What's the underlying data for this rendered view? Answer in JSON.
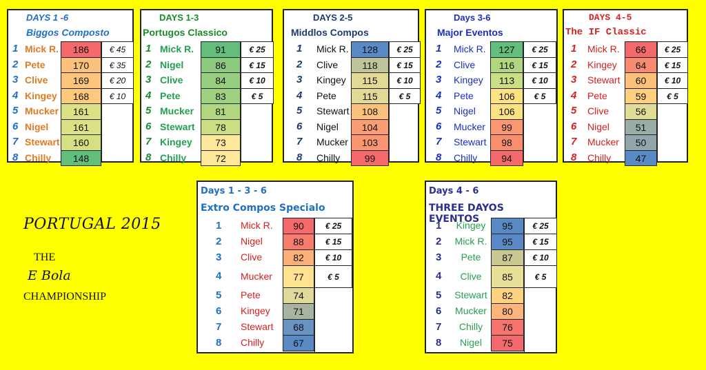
{
  "side_text": {
    "title": "PORTUGAL 2015",
    "the": "THE",
    "name": "E Bola",
    "championship": "CHAMPIONSHIP"
  },
  "tables": [
    {
      "days": "DAYS 1 -6",
      "title": "Biggos Composto",
      "title_color": "#1f6fc5",
      "name_color": "#e07b22",
      "rank_color": "#1f6fc5",
      "rows": [
        {
          "rank": "1",
          "name": "Mick R.",
          "score": "186",
          "color": "#f4696b",
          "prize": "€ 45"
        },
        {
          "rank": "2",
          "name": "Pete",
          "score": "170",
          "color": "#fcc17c",
          "prize": "€ 35"
        },
        {
          "rank": "3",
          "name": "Clive",
          "score": "169",
          "color": "#fcc47c",
          "prize": "€ 20"
        },
        {
          "rank": "4",
          "name": "Kingey",
          "score": "168",
          "color": "#fcc97d",
          "prize": "€ 10"
        },
        {
          "rank": "5",
          "name": "Mucker",
          "score": "161",
          "color": "#dce283",
          "prize": ""
        },
        {
          "rank": "6",
          "name": "Nigel",
          "score": "161",
          "color": "#dce283",
          "prize": ""
        },
        {
          "rank": "7",
          "name": "Stewart",
          "score": "160",
          "color": "#d5e083",
          "prize": ""
        },
        {
          "rank": "8",
          "name": "Chilly",
          "score": "148",
          "color": "#63be7b",
          "prize": ""
        }
      ]
    },
    {
      "days": "DAYS 1-3",
      "title": "Portugos Classico",
      "title_color": "#1a8a2a",
      "name_color": "#25a050",
      "rank_color": "#1a8a2a",
      "rows": [
        {
          "rank": "1",
          "name": "Mick R.",
          "score": "91",
          "color": "#63be7b",
          "prize": "€ 25"
        },
        {
          "rank": "2",
          "name": "Nigel",
          "score": "86",
          "color": "#8ccb7e",
          "prize": "€ 15"
        },
        {
          "rank": "3",
          "name": "Clive",
          "score": "84",
          "color": "#97ce7f",
          "prize": "€ 10"
        },
        {
          "rank": "4",
          "name": "Pete",
          "score": "83",
          "color": "#a0d180",
          "prize": "€ 5"
        },
        {
          "rank": "5",
          "name": "Mucker",
          "score": "81",
          "color": "#b1d680",
          "prize": ""
        },
        {
          "rank": "6",
          "name": "Stewart",
          "score": "78",
          "color": "#cade83",
          "prize": ""
        },
        {
          "rank": "7",
          "name": "Kingey",
          "score": "73",
          "color": "#fde89a",
          "prize": ""
        },
        {
          "rank": "8",
          "name": "Chilly",
          "score": "72",
          "color": "#fde89a",
          "prize": ""
        }
      ]
    },
    {
      "days": "DAYS 2-5",
      "title": "Middlos Compos",
      "title_color": "#1f3a70",
      "name_color": "#111111",
      "rank_color": "#1f3a70",
      "rows": [
        {
          "rank": "1",
          "name": "Mick R.",
          "score": "128",
          "color": "#5a8ac6",
          "prize": "€ 25"
        },
        {
          "rank": "2",
          "name": "Clive",
          "score": "118",
          "color": "#bfc49b",
          "prize": "€ 15"
        },
        {
          "rank": "3",
          "name": "Kingey",
          "score": "115",
          "color": "#e1d995",
          "prize": "€ 10"
        },
        {
          "rank": "4",
          "name": "Pete",
          "score": "115",
          "color": "#e1d995",
          "prize": "€ 5"
        },
        {
          "rank": "5",
          "name": "Stewart",
          "score": "108",
          "color": "#fcc27c",
          "prize": ""
        },
        {
          "rank": "6",
          "name": "Nigel",
          "score": "104",
          "color": "#fa9c74",
          "prize": ""
        },
        {
          "rank": "7",
          "name": "Mucker",
          "score": "103",
          "color": "#fa9572",
          "prize": ""
        },
        {
          "rank": "8",
          "name": "Chilly",
          "score": "99",
          "color": "#f4696b",
          "prize": ""
        }
      ]
    },
    {
      "days": "Days 3-6",
      "title": "Major Eventos",
      "title_color": "#1a2fc0",
      "name_color": "#1a2fc0",
      "rank_color": "#1a2fc0",
      "rows": [
        {
          "rank": "1",
          "name": "Mick R.",
          "score": "127",
          "color": "#63be7b",
          "prize": "€ 25"
        },
        {
          "rank": "2",
          "name": "Clive",
          "score": "116",
          "color": "#b1d680",
          "prize": "€ 15"
        },
        {
          "rank": "3",
          "name": "Kingey",
          "score": "113",
          "color": "#cade83",
          "prize": "€ 10"
        },
        {
          "rank": "4",
          "name": "Pete",
          "score": "106",
          "color": "#fde283",
          "prize": "€ 5"
        },
        {
          "rank": "5",
          "name": "Nigel",
          "score": "106",
          "color": "#fde283",
          "prize": ""
        },
        {
          "rank": "6",
          "name": "Mucker",
          "score": "99",
          "color": "#fa9873",
          "prize": ""
        },
        {
          "rank": "7",
          "name": "Stewart",
          "score": "98",
          "color": "#f8906f",
          "prize": ""
        },
        {
          "rank": "8",
          "name": "Chilly",
          "score": "94",
          "color": "#f4696b",
          "prize": ""
        }
      ]
    },
    {
      "days": "DAYS 4-5",
      "title": "The IF Classic",
      "title_color": "#d42020",
      "name_color": "#d42020",
      "rank_color": "#d42020",
      "rows": [
        {
          "rank": "1",
          "name": "Mick R.",
          "score": "66",
          "color": "#f4696b",
          "prize": "€ 25"
        },
        {
          "rank": "2",
          "name": "Kingey",
          "score": "64",
          "color": "#f98c70",
          "prize": "€ 15"
        },
        {
          "rank": "3",
          "name": "Stewart",
          "score": "60",
          "color": "#fcc27c",
          "prize": "€ 10"
        },
        {
          "rank": "4",
          "name": "Pete",
          "score": "59",
          "color": "#fcd07f",
          "prize": "€ 5"
        },
        {
          "rank": "5",
          "name": "Clive",
          "score": "56",
          "color": "#e1dd97",
          "prize": ""
        },
        {
          "rank": "6",
          "name": "Nigel",
          "score": "51",
          "color": "#9aaea6",
          "prize": ""
        },
        {
          "rank": "7",
          "name": "Mucker",
          "score": "50",
          "color": "#8fa6ab",
          "prize": ""
        },
        {
          "rank": "8",
          "name": "Chilly",
          "score": "47",
          "color": "#5a8ac6",
          "prize": ""
        }
      ]
    },
    {
      "days": "Days 1 - 3 - 6",
      "title": "Extro Compos Specialo",
      "title_color": "#1f6fc5",
      "name_color": "#d42020",
      "rank_color": "#1f6fc5",
      "rows": [
        {
          "rank": "1",
          "name": "Mick R.",
          "score": "90",
          "color": "#f4696b",
          "prize": "€ 25"
        },
        {
          "rank": "2",
          "name": "Nigel",
          "score": "88",
          "color": "#f67d6e",
          "prize": "€ 15"
        },
        {
          "rank": "3",
          "name": "Clive",
          "score": "82",
          "color": "#fbb079",
          "prize": "€ 10"
        },
        {
          "rank": "4",
          "name": "Mucker",
          "score": "77",
          "color": "#fde290",
          "prize": "€ 5"
        },
        {
          "rank": "5",
          "name": "Pete",
          "score": "74",
          "color": "#dfd99a",
          "prize": ""
        },
        {
          "rank": "6",
          "name": "Kingey",
          "score": "71",
          "color": "#a8b3a2",
          "prize": ""
        },
        {
          "rank": "7",
          "name": "Stewart",
          "score": "68",
          "color": "#6a93c3",
          "prize": ""
        },
        {
          "rank": "8",
          "name": "Chilly",
          "score": "67",
          "color": "#5a8ac6",
          "prize": ""
        }
      ]
    },
    {
      "days": "Days 4 - 6",
      "title": "THREE DAYOS EVENTOS",
      "title_color": "#2a2f90",
      "name_color": "#25a050",
      "rank_color": "#2a2f90",
      "rows": [
        {
          "rank": "1",
          "name": "Kingey",
          "score": "95",
          "color": "#5a8ac6",
          "prize": "€ 25"
        },
        {
          "rank": "2",
          "name": "Mick R.",
          "score": "95",
          "color": "#5a8ac6",
          "prize": "€ 15"
        },
        {
          "rank": "3",
          "name": "Pete",
          "score": "87",
          "color": "#cac793",
          "prize": "€ 10"
        },
        {
          "rank": "4",
          "name": "Clive",
          "score": "85",
          "color": "#e7df98",
          "prize": "€ 5"
        },
        {
          "rank": "5",
          "name": "Stewart",
          "score": "82",
          "color": "#fdd382",
          "prize": ""
        },
        {
          "rank": "6",
          "name": "Mucker",
          "score": "80",
          "color": "#fbb57a",
          "prize": ""
        },
        {
          "rank": "7",
          "name": "Chilly",
          "score": "76",
          "color": "#f67470",
          "prize": ""
        },
        {
          "rank": "8",
          "name": "Nigel",
          "score": "75",
          "color": "#f4696b",
          "prize": ""
        }
      ]
    }
  ]
}
